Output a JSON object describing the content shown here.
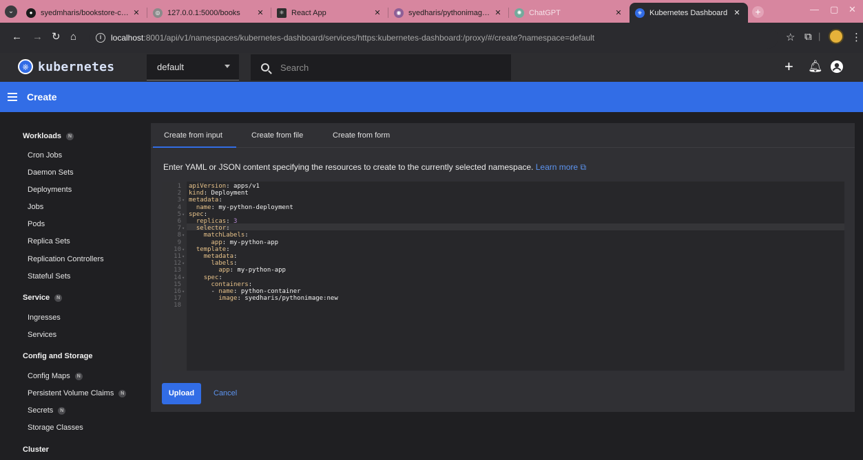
{
  "browser": {
    "tabs": [
      {
        "title": "syedmharis/bookstore-crud",
        "icon": "github-icon"
      },
      {
        "title": "127.0.0.1:5000/books",
        "icon": "globe-icon"
      },
      {
        "title": "React App",
        "icon": "react-icon"
      },
      {
        "title": "syedharis/pythonimage - Doc",
        "icon": "docker-icon"
      },
      {
        "title": "ChatGPT",
        "icon": "chatgpt-icon"
      },
      {
        "title": "Kubernetes Dashboard",
        "icon": "kubernetes-icon",
        "active": true
      }
    ],
    "url_host": "localhost",
    "url_rest": ":8001/api/v1/namespaces/kubernetes-dashboard/services/https:kubernetes-dashboard:/proxy/#/create?namespace=default"
  },
  "app": {
    "name": "kubernetes",
    "namespace": "default",
    "search_placeholder": "Search",
    "page_title": "Create"
  },
  "sidebar": {
    "sections": [
      {
        "label": "Workloads",
        "badge": "N"
      },
      {
        "label": "Service",
        "badge": "N"
      },
      {
        "label": "Config and Storage"
      },
      {
        "label": "Cluster"
      }
    ],
    "workloads": [
      "Cron Jobs",
      "Daemon Sets",
      "Deployments",
      "Jobs",
      "Pods",
      "Replica Sets",
      "Replication Controllers",
      "Stateful Sets"
    ],
    "service": [
      "Ingresses",
      "Services"
    ],
    "config": [
      {
        "label": "Config Maps",
        "badge": "N"
      },
      {
        "label": "Persistent Volume Claims",
        "badge": "N"
      },
      {
        "label": "Secrets",
        "badge": "N"
      },
      {
        "label": "Storage Classes"
      }
    ]
  },
  "create": {
    "tabs": [
      "Create from input",
      "Create from file",
      "Create from form"
    ],
    "intro": "Enter YAML or JSON content specifying the resources to create to the currently selected namespace.",
    "learn_more": "Learn more",
    "code": [
      {
        "n": "1",
        "fold": "",
        "key": "apiVersion",
        "val": "apps/v1",
        "indent": ""
      },
      {
        "n": "2",
        "fold": "",
        "key": "kind",
        "val": "Deployment",
        "indent": ""
      },
      {
        "n": "3",
        "fold": "▾",
        "key": "metadata",
        "val": "",
        "indent": ""
      },
      {
        "n": "4",
        "fold": "",
        "key": "name",
        "val": "my-python-deployment",
        "indent": "  "
      },
      {
        "n": "5",
        "fold": "▾",
        "key": "spec",
        "val": "",
        "indent": ""
      },
      {
        "n": "6",
        "fold": "",
        "key": "replicas",
        "num": "3",
        "indent": "  "
      },
      {
        "n": "7",
        "fold": "▾",
        "key": "selector",
        "val": "",
        "indent": "  "
      },
      {
        "n": "8",
        "fold": "▾",
        "key": "matchLabels",
        "val": "",
        "indent": "    "
      },
      {
        "n": "9",
        "fold": "",
        "key": "app",
        "val": "my-python-app",
        "indent": "      "
      },
      {
        "n": "10",
        "fold": "▾",
        "key": "template",
        "val": "",
        "indent": "  "
      },
      {
        "n": "11",
        "fold": "▾",
        "key": "metadata",
        "val": "",
        "indent": "    "
      },
      {
        "n": "12",
        "fold": "▾",
        "key": "labels",
        "val": "",
        "indent": "      "
      },
      {
        "n": "13",
        "fold": "",
        "key": "app",
        "val": "my-python-app",
        "indent": "        "
      },
      {
        "n": "14",
        "fold": "▾",
        "key": "spec",
        "val": "",
        "indent": "    "
      },
      {
        "n": "15",
        "fold": "",
        "key": "containers",
        "val": "",
        "indent": "      "
      },
      {
        "n": "16",
        "fold": "▾",
        "dash": "- ",
        "key": "name",
        "val": "python-container",
        "indent": "      "
      },
      {
        "n": "17",
        "fold": "",
        "key": "image",
        "val": "syedharis/pythonimage:new",
        "indent": "        "
      },
      {
        "n": "18",
        "fold": "",
        "key": "",
        "val": "",
        "indent": ""
      }
    ],
    "upload_label": "Upload",
    "cancel_label": "Cancel"
  },
  "colors": {
    "accent": "#326de6",
    "link": "#5d94f0",
    "tabstrip": "#d7869f"
  }
}
